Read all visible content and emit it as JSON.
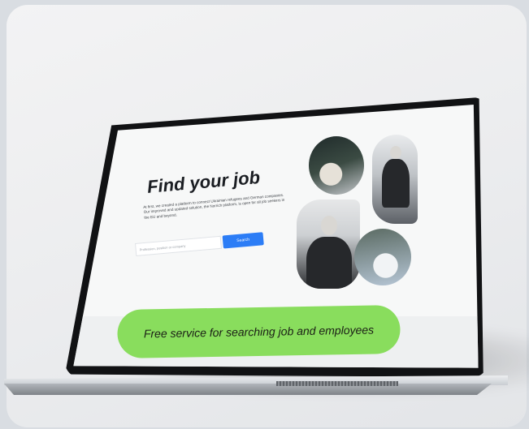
{
  "hero": {
    "title": "Find your job",
    "description": "At first, we created a platform to connect Ukrainian refugees and German companies. Our improved and updated solution, the Norrich platform, is open for all job seekers in the EU and beyond."
  },
  "search": {
    "placeholder": "Profession, position or company",
    "button_label": "Search"
  },
  "cta": {
    "label": "Free service for searching job and employees"
  },
  "colors": {
    "accent_blue": "#2c7df6",
    "cta_green": "#89dd5d",
    "background": "#ebecee"
  }
}
